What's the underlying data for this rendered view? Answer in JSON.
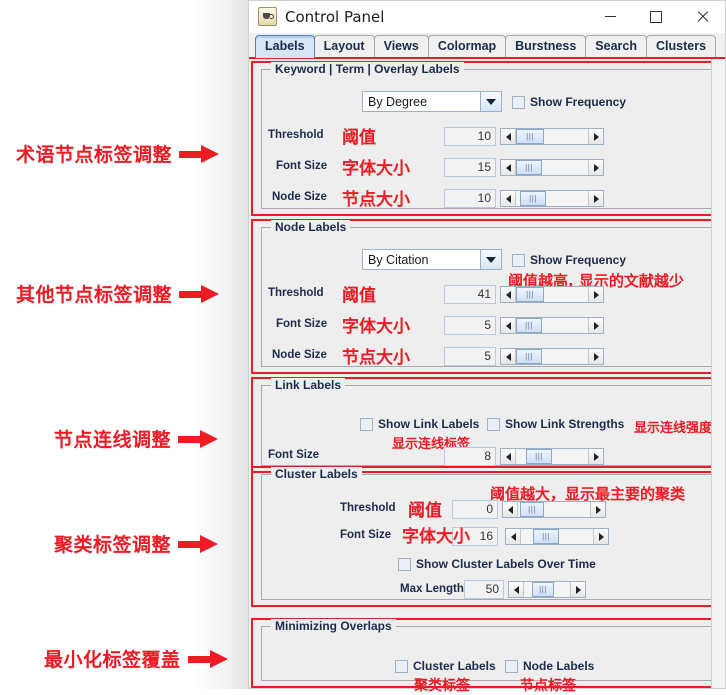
{
  "window": {
    "title": "Control Panel",
    "icon": "java-coffee-cup-icon",
    "minimize_label": "Minimize",
    "maximize_label": "Maximize",
    "close_label": "Close"
  },
  "tabs": [
    {
      "label": "Labels",
      "selected": true
    },
    {
      "label": "Layout",
      "selected": false
    },
    {
      "label": "Views",
      "selected": false
    },
    {
      "label": "Colormap",
      "selected": false
    },
    {
      "label": "Burstness",
      "selected": false
    },
    {
      "label": "Search",
      "selected": false
    },
    {
      "label": "Clusters",
      "selected": false
    }
  ],
  "annotations": [
    {
      "text": "术语节点标签调整"
    },
    {
      "text": "其他节点标签调整"
    },
    {
      "text": "节点连线调整"
    },
    {
      "text": "聚类标签调整"
    },
    {
      "text": "最小化标签覆盖"
    }
  ],
  "groups": {
    "keyword": {
      "title": "Keyword | Term | Overlay Labels",
      "combo_value": "By Degree",
      "show_frequency_label": "Show Frequency",
      "show_frequency_checked": false,
      "rows": [
        {
          "label": "Threshold",
          "cn": "阈值",
          "value": "10"
        },
        {
          "label": "Font Size",
          "cn": "字体大小",
          "value": "15"
        },
        {
          "label": "Node Size",
          "cn": "节点大小",
          "value": "10"
        }
      ]
    },
    "node": {
      "title": "Node Labels",
      "combo_value": "By Citation",
      "show_frequency_label": "Show Frequency",
      "show_frequency_checked": false,
      "note": "阈值越高, 显示的文献越少",
      "rows": [
        {
          "label": "Threshold",
          "cn": "阈值",
          "value": "41"
        },
        {
          "label": "Font Size",
          "cn": "字体大小",
          "value": "5"
        },
        {
          "label": "Node Size",
          "cn": "节点大小",
          "value": "5"
        }
      ]
    },
    "link": {
      "title": "Link Labels",
      "show_link_labels_label": "Show Link Labels",
      "show_link_labels_checked": false,
      "show_link_labels_cn": "显示连线标签",
      "show_link_strengths_label": "Show Link Strengths",
      "show_link_strengths_checked": false,
      "show_link_strengths_cn": "显示连线强度",
      "font_size_label": "Font Size",
      "font_size_value": "8"
    },
    "cluster": {
      "title": "Cluster Labels",
      "note": "阈值越大，显示最主要的聚类",
      "threshold_label": "Threshold",
      "threshold_cn": "阈值",
      "threshold_value": "0",
      "font_size_label": "Font Size",
      "font_size_cn": "字体大小",
      "font_size_value": "16",
      "over_time_label": "Show Cluster Labels Over Time",
      "over_time_checked": false,
      "max_length_label": "Max Length",
      "max_length_value": "50"
    },
    "overlaps": {
      "title": "Minimizing Overlaps",
      "cluster_labels_label": "Cluster Labels",
      "cluster_labels_checked": false,
      "cluster_labels_cn": "聚类标签",
      "node_labels_label": "Node Labels",
      "node_labels_checked": false,
      "node_labels_cn": "节点标签"
    }
  },
  "colors": {
    "annotation_red": "#ee1b24",
    "panel_bg": "#eeeeee",
    "tab_selected": "#d6e6f8",
    "label_text": "#1b2b4b"
  }
}
